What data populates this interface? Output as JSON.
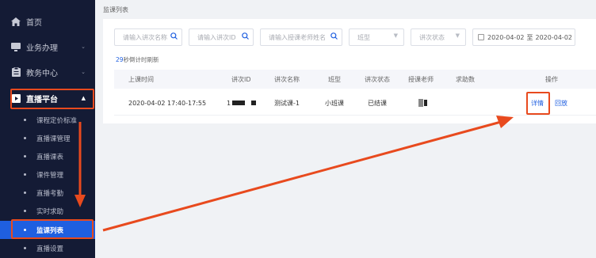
{
  "sidebar": {
    "menu": [
      {
        "label": "首页",
        "icon": "home-icon"
      },
      {
        "label": "业务办理",
        "icon": "monitor-icon"
      },
      {
        "label": "教务中心",
        "icon": "clipboard-icon"
      },
      {
        "label": "直播平台",
        "icon": "live-play-icon"
      }
    ],
    "submenu": [
      {
        "label": "课程定价标准"
      },
      {
        "label": "直播课管理"
      },
      {
        "label": "直播课表"
      },
      {
        "label": "课件管理"
      },
      {
        "label": "直播考勤"
      },
      {
        "label": "实时求助"
      },
      {
        "label": "监课列表",
        "active": true
      },
      {
        "label": "直播设置"
      }
    ]
  },
  "breadcrumb": "监课列表",
  "filters": {
    "lecture_name_placeholder": "请输入讲次名称",
    "lecture_id_placeholder": "请输入讲次ID",
    "teacher_placeholder": "请输入授课老师姓名",
    "class_type_placeholder": "班型",
    "lecture_status_placeholder": "讲次状态",
    "date_start": "2020-04-02",
    "date_separator": "至",
    "date_end": "2020-04-02"
  },
  "refresh": {
    "seconds": "29",
    "text": "秒倒计时刷新"
  },
  "table": {
    "headers": [
      "上课时间",
      "讲次ID",
      "讲次名称",
      "班型",
      "讲次状态",
      "授课老师",
      "求助数",
      "操作"
    ],
    "rows": [
      {
        "time": "2020-04-02 17:40-17:55",
        "id_prefix": "1",
        "name": "测试课-1",
        "class_type": "小班课",
        "status": "已结课",
        "help_count": "",
        "action_detail": "详情",
        "action_replay": "回放"
      }
    ]
  },
  "colors": {
    "sidebar_bg": "#141b35",
    "accent": "#1f5fe0",
    "annotation": "#e84a1e"
  }
}
